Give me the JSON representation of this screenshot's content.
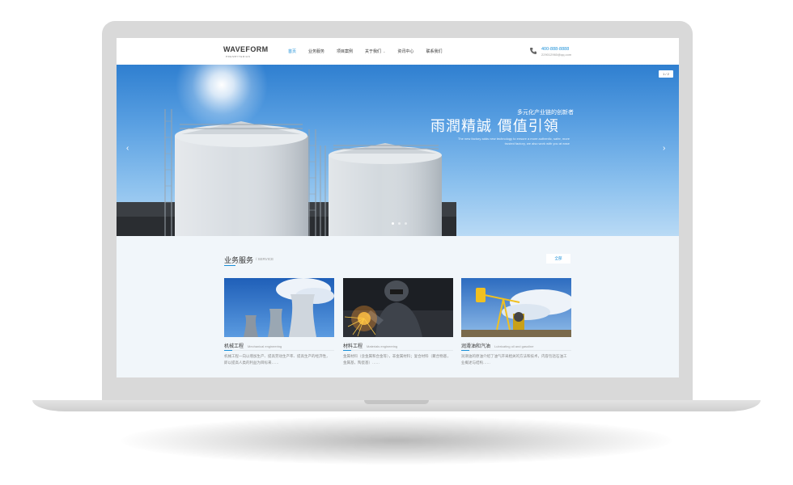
{
  "logo": {
    "text": "WAVEFORM",
    "tagline": "PRESBYTERIAN"
  },
  "nav": {
    "items": [
      "首页",
      "业务服务",
      "项目案例",
      "关于我们",
      "资讯中心",
      "联系我们"
    ],
    "active_index": 0,
    "dropdown_index": 3
  },
  "contact": {
    "phone": "400-888-8888",
    "email": "229012960@qq.com"
  },
  "banner": {
    "counter": "1 / 2",
    "tagline": "多元化产业链的创新者",
    "headline": "雨潤精誠  價值引領",
    "description": "The new factory adds new technology to ensure a more authentic, safer, more trusted factory, we also work with you at ease",
    "slide_count": 3,
    "active_slide": 0
  },
  "services": {
    "title": "业务服务",
    "title_en": "/ SERVICE",
    "all_button": "全部",
    "cards": [
      {
        "title": "机械工程",
        "title_en": "Mechanical engineering",
        "description": "机械工程一向以增加生产、提高劳动生产率、提高生产的经济性，即以提高人类的利益为目标来……",
        "image": "cooling-towers"
      },
      {
        "title": "材料工程",
        "title_en": "Materials engineering",
        "description": "金属材料（含金属和合金等），非金属材料；复合材料（聚合物基，金属基，陶瓷基）……",
        "image": "welder"
      },
      {
        "title": "润滑油和汽油",
        "title_en": "Lubricating oil and gasoline",
        "description": "润滑油的原油介绍了油气开采相关的方法和技术，内容包括石油工业概述与结构……",
        "image": "oil-pump"
      }
    ]
  },
  "colors": {
    "accent": "#1a8fd8",
    "nav_bg": "#ffffff",
    "page_bg": "#f1f6fa"
  }
}
